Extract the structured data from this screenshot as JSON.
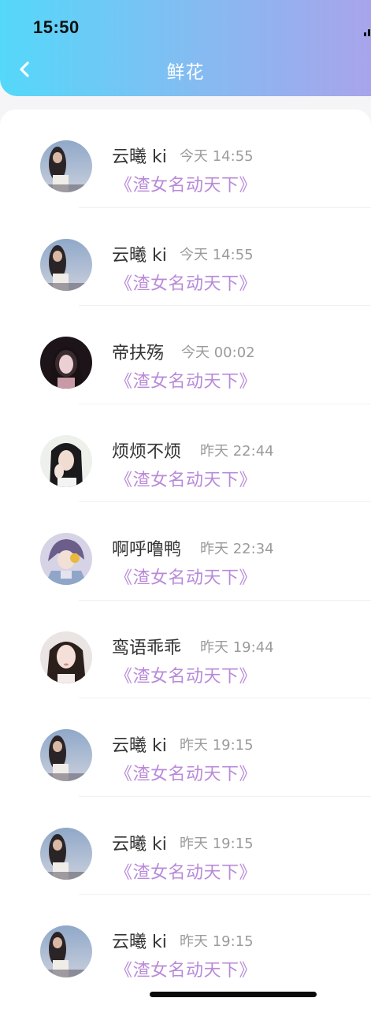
{
  "status_bar": {
    "time": "15:50"
  },
  "header": {
    "title": "鲜花",
    "back_icon": "chevron-left-icon",
    "gradient_start": "#54d8fa",
    "gradient_end": "#a8a4eb"
  },
  "colors": {
    "gift_title": "#b98ad9",
    "name": "#333333",
    "time": "#9b9b9b"
  },
  "items": [
    {
      "name": "云曦 ki",
      "time": "今天 14:55",
      "gift": "《渣女名动天下》",
      "avatar": "girl-sky-avatar"
    },
    {
      "name": "云曦 ki",
      "time": "今天 14:55",
      "gift": "《渣女名动天下》",
      "avatar": "girl-sky-avatar"
    },
    {
      "name": "帝扶殇",
      "time": "今天 00:02",
      "gift": "《渣女名动天下》",
      "avatar": "dark-hair-pink-avatar"
    },
    {
      "name": "烦烦不烦",
      "time": "昨天 22:44",
      "gift": "《渣女名动天下》",
      "avatar": "girl-hand-avatar"
    },
    {
      "name": "啊呼噜鸭",
      "time": "昨天 22:34",
      "gift": "《渣女名动天下》",
      "avatar": "anime-boy-avatar"
    },
    {
      "name": "鸾语乖乖",
      "time": "昨天 19:44",
      "gift": "《渣女名动天下》",
      "avatar": "girl-portrait-avatar"
    },
    {
      "name": "云曦 ki",
      "time": "昨天 19:15",
      "gift": "《渣女名动天下》",
      "avatar": "girl-sky-avatar"
    },
    {
      "name": "云曦 ki",
      "time": "昨天 19:15",
      "gift": "《渣女名动天下》",
      "avatar": "girl-sky-avatar"
    },
    {
      "name": "云曦 ki",
      "time": "昨天 19:15",
      "gift": "《渣女名动天下》",
      "avatar": "girl-sky-avatar"
    }
  ]
}
